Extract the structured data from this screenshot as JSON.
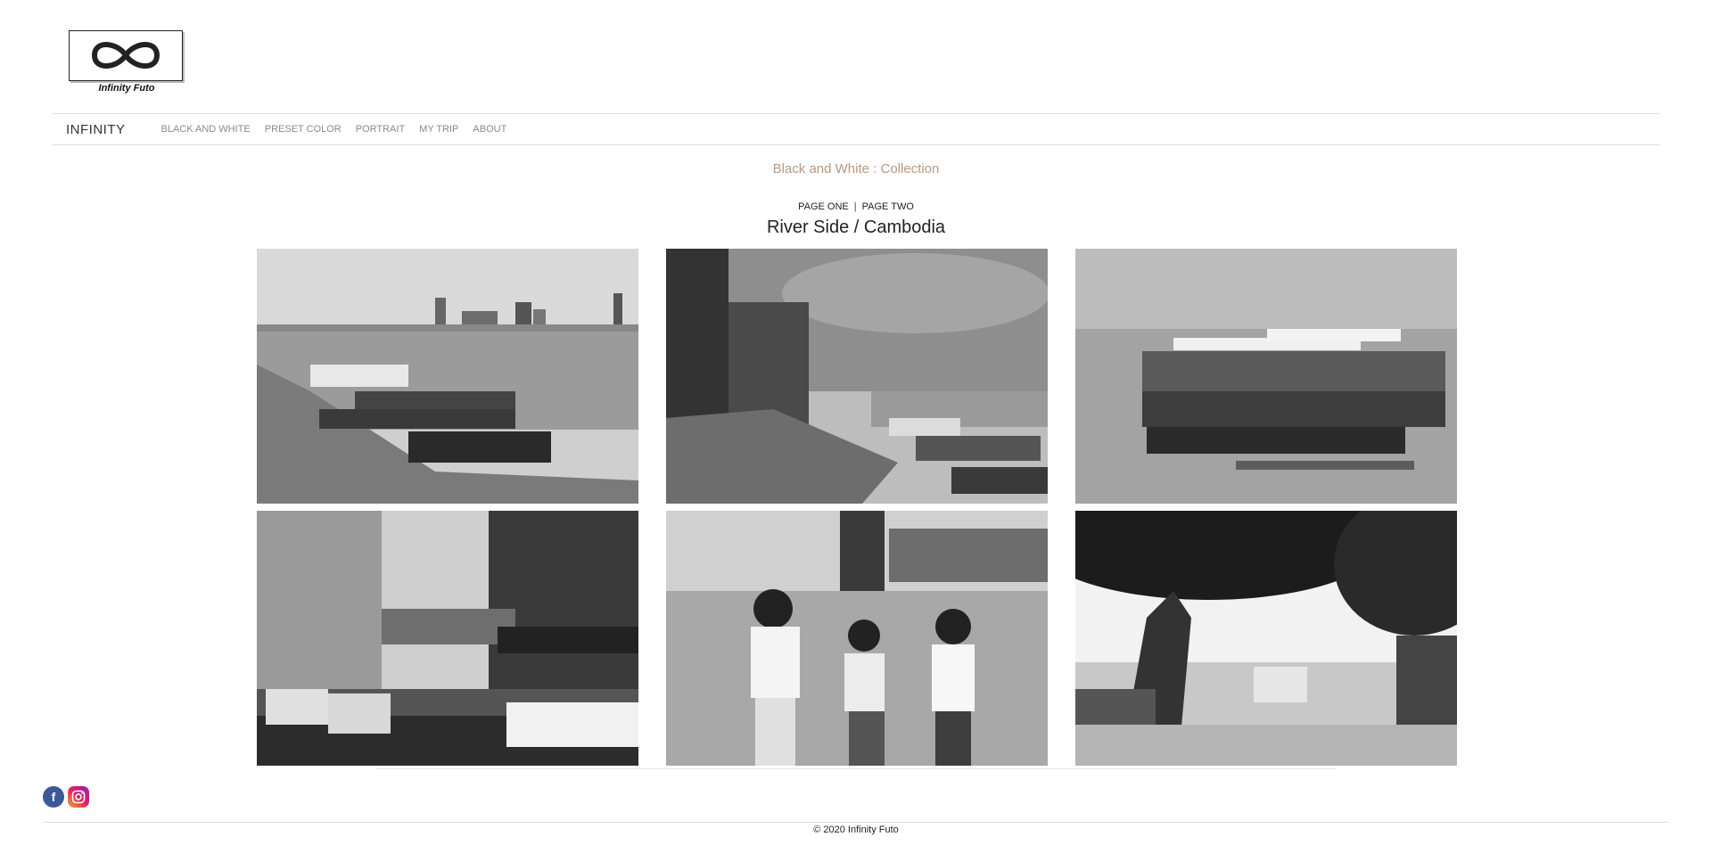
{
  "logo": {
    "caption": "Infinity Futo",
    "icon": "infinity-icon"
  },
  "nav": {
    "brand": "INFINITY",
    "items": [
      "BLACK AND WHITE",
      "PRESET COLOR",
      "PORTRAIT",
      "MY TRIP",
      "ABOUT"
    ]
  },
  "page": {
    "section_title": "Black and White : Collection",
    "pager": {
      "page_one": "PAGE ONE",
      "separator": "|",
      "page_two": "PAGE TWO"
    },
    "gallery_title": "River Side / Cambodia"
  },
  "gallery": {
    "photos": [
      "riverbank-boats-photo",
      "promenade-flags-photo",
      "docked-boat-photo",
      "street-buildings-photo",
      "children-walking-photo",
      "tree-park-photo"
    ]
  },
  "social": {
    "icons": [
      "facebook-icon",
      "instagram-icon"
    ]
  },
  "footer": {
    "copyright": "© 2020 Infinity Futo"
  },
  "colors": {
    "section_title": "#b49a82",
    "nav_item": "#8a8a8a",
    "facebook": "#3b5998"
  }
}
